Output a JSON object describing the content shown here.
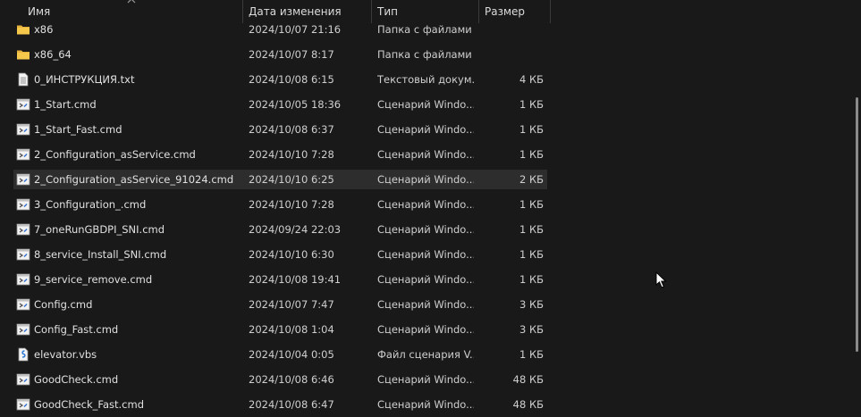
{
  "header": {
    "name_label": "Имя",
    "date_label": "Дата изменения",
    "type_label": "Тип",
    "size_label": "Размер"
  },
  "files": [
    {
      "icon": "folder-icon",
      "name": "x86",
      "date": "2024/10/07 21:16",
      "type": "Папка с файлами",
      "size": ""
    },
    {
      "icon": "folder-icon",
      "name": "x86_64",
      "date": "2024/10/07 8:17",
      "type": "Папка с файлами",
      "size": ""
    },
    {
      "icon": "text-file-icon",
      "name": "0_ИНСТРУКЦИЯ.txt",
      "date": "2024/10/08 6:15",
      "type": "Текстовый докум...",
      "size": "4 КБ"
    },
    {
      "icon": "cmd-file-icon",
      "name": "1_Start.cmd",
      "date": "2024/10/05 18:36",
      "type": "Сценарий Windo...",
      "size": "1 КБ"
    },
    {
      "icon": "cmd-file-icon",
      "name": "1_Start_Fast.cmd",
      "date": "2024/10/08 6:37",
      "type": "Сценарий Windo...",
      "size": "1 КБ"
    },
    {
      "icon": "cmd-file-icon",
      "name": "2_Configuration_asService.cmd",
      "date": "2024/10/10 7:28",
      "type": "Сценарий Windo...",
      "size": "1 КБ"
    },
    {
      "icon": "cmd-file-icon",
      "name": "2_Configuration_asService_91024.cmd",
      "date": "2024/10/10 6:25",
      "type": "Сценарий Windo...",
      "size": "2 КБ",
      "selected": true
    },
    {
      "icon": "cmd-file-icon",
      "name": "3_Configuration_.cmd",
      "date": "2024/10/10 7:28",
      "type": "Сценарий Windo...",
      "size": "1 КБ"
    },
    {
      "icon": "cmd-file-icon",
      "name": "7_oneRunGBDPI_SNI.cmd",
      "date": "2024/09/24 22:03",
      "type": "Сценарий Windo...",
      "size": "1 КБ"
    },
    {
      "icon": "cmd-file-icon",
      "name": "8_service_Install_SNI.cmd",
      "date": "2024/10/10 6:30",
      "type": "Сценарий Windo...",
      "size": "1 КБ"
    },
    {
      "icon": "cmd-file-icon",
      "name": "9_service_remove.cmd",
      "date": "2024/10/08 19:41",
      "type": "Сценарий Windo...",
      "size": "1 КБ"
    },
    {
      "icon": "cmd-file-icon",
      "name": "Config.cmd",
      "date": "2024/10/07 7:47",
      "type": "Сценарий Windo...",
      "size": "3 КБ"
    },
    {
      "icon": "cmd-file-icon",
      "name": "Config_Fast.cmd",
      "date": "2024/10/08 1:04",
      "type": "Сценарий Windo...",
      "size": "3 КБ"
    },
    {
      "icon": "vbs-file-icon",
      "name": "elevator.vbs",
      "date": "2024/10/04 0:05",
      "type": "Файл сценария V...",
      "size": "1 КБ"
    },
    {
      "icon": "cmd-file-icon",
      "name": "GoodCheck.cmd",
      "date": "2024/10/08 6:46",
      "type": "Сценарий Windo...",
      "size": "48 КБ"
    },
    {
      "icon": "cmd-file-icon",
      "name": "GoodCheck_Fast.cmd",
      "date": "2024/10/08 6:47",
      "type": "Сценарий Windo...",
      "size": "48 КБ"
    }
  ],
  "colors": {
    "background": "#191919",
    "selected_row": "#2d2d2d",
    "folder": "#f0c04a",
    "text": "#e0e0e0"
  },
  "sort_indicator": "chevron-up-icon"
}
